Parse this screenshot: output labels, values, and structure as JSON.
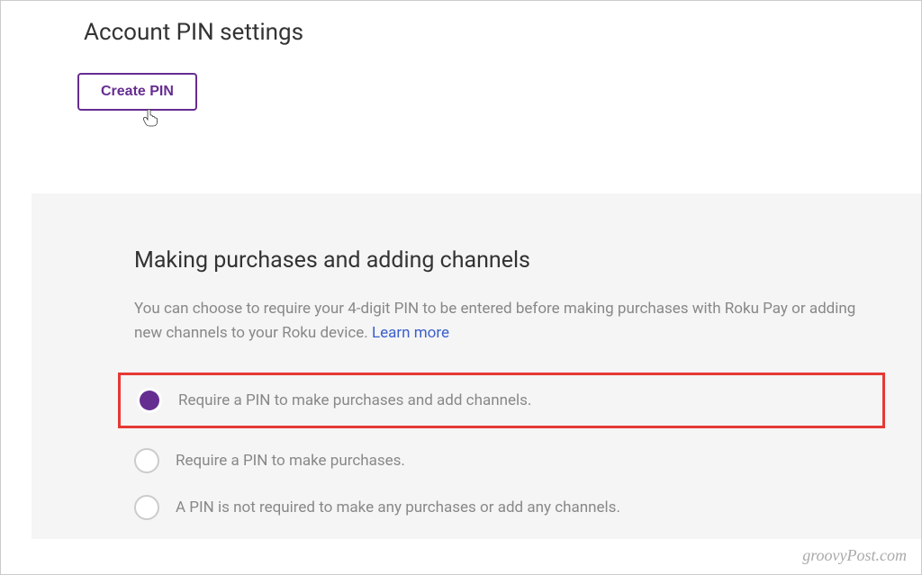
{
  "header": {
    "title": "Account PIN settings",
    "create_pin_label": "Create PIN"
  },
  "section": {
    "title": "Making purchases and adding channels",
    "description_prefix": "You can choose to require your 4-digit PIN to be entered before making purchases with Roku Pay or adding new channels to your Roku device. ",
    "learn_more_label": "Learn more",
    "options": [
      {
        "label": "Require a PIN to make purchases and add channels.",
        "selected": true
      },
      {
        "label": "Require a PIN to make purchases.",
        "selected": false
      },
      {
        "label": "A PIN is not required to make any purchases or add any channels.",
        "selected": false
      }
    ]
  },
  "watermark": "groovyPost.com"
}
